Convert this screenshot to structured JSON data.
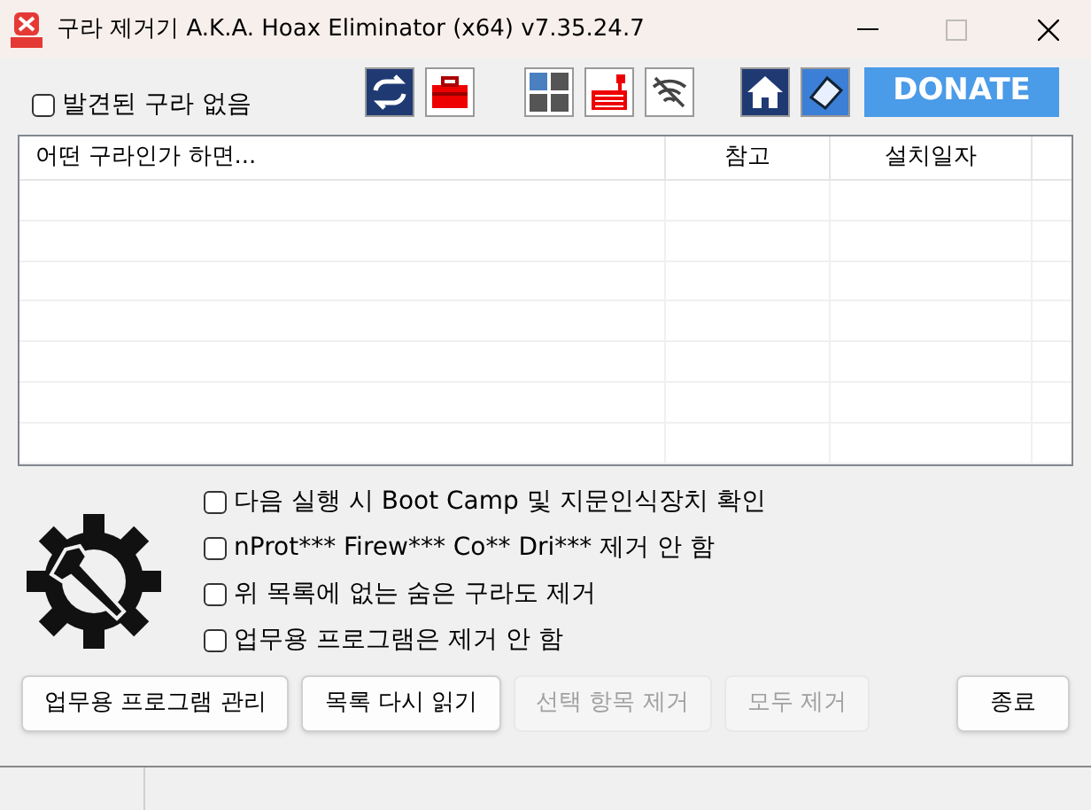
{
  "window": {
    "title": "구라 제거기 A.K.A. Hoax Eliminator (x64) v7.35.24.7"
  },
  "no_hoax_checkbox": {
    "label": "발견된 구라 없음",
    "checked": false
  },
  "donate_button": {
    "label": "DONATE"
  },
  "list": {
    "columns": [
      "어떤 구라인가 하면...",
      "참고",
      "설치일자"
    ]
  },
  "options": [
    {
      "label": "다음 실행 시 Boot Camp 및 지문인식장치 확인",
      "checked": false
    },
    {
      "label": "nProt*** Firew*** Co** Dri*** 제거 안 함",
      "checked": false
    },
    {
      "label": "위 목록에 없는 숨은 구라도 제거",
      "checked": false
    },
    {
      "label": "업무용 프로그램은 제거 안 함",
      "checked": false
    }
  ],
  "buttons": [
    {
      "label": "업무용 프로그램 관리",
      "disabled": false
    },
    {
      "label": "목록 다시 읽기",
      "disabled": false
    },
    {
      "label": "선택 항목 제거",
      "disabled": true
    },
    {
      "label": "모두 제거",
      "disabled": true
    },
    {
      "label": "종료",
      "disabled": false
    }
  ]
}
